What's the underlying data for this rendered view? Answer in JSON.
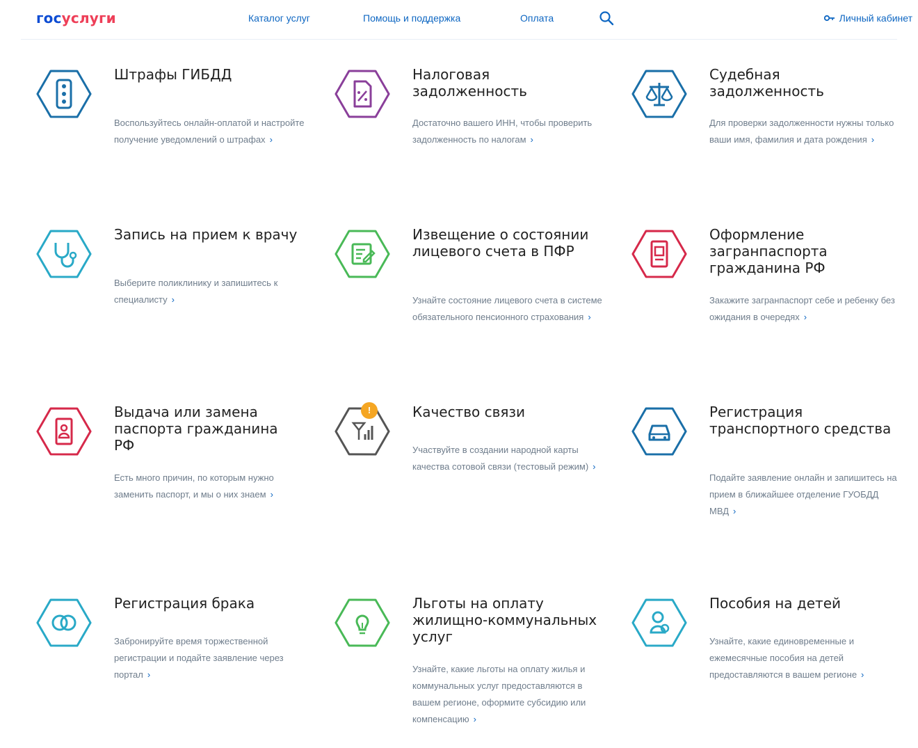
{
  "header": {
    "logo_part1": "гос",
    "logo_part2": "услуги",
    "nav": [
      "Каталог услуг",
      "Помощь и поддержка",
      "Оплата"
    ],
    "account_label": "Личный кабинет"
  },
  "colors": {
    "brand_blue": "#0d4cd3",
    "brand_red": "#ee3f58",
    "link": "#0d66c2"
  },
  "services": [
    {
      "title": "Штрафы ГИБДД",
      "description": "Воспользуйтесь онлайн-оплатой и настройте получение уведомлений о штрафах",
      "icon": "traffic-light-icon",
      "color": "#1a6fa8"
    },
    {
      "title": "Налоговая задолженность",
      "description": "Достаточно вашего ИНН, чтобы проверить задолженность по налогам",
      "icon": "tax-document-icon",
      "color": "#8a3f9a"
    },
    {
      "title": "Судебная задолженность",
      "description": "Для проверки задолженности нужны только ваши имя, фамилия и дата рождения",
      "icon": "scales-icon",
      "color": "#1a6fa8"
    },
    {
      "title": "Запись на прием к врачу",
      "description": "Выберите поликлинику и запишитесь к специалисту",
      "icon": "stethoscope-icon",
      "color": "#29a9c7"
    },
    {
      "title": "Извещение о состоянии лицевого счета в ПФР",
      "description": "Узнайте состояние лицевого счета в системе обязательного пенсионного страхования",
      "icon": "edit-document-icon",
      "color": "#49b957"
    },
    {
      "title": "Оформление загранпаспорта гражданина РФ",
      "description": "Закажите загранпаспорт себе и ребенку без ожидания в очередях",
      "icon": "passport-icon",
      "color": "#d6294a"
    },
    {
      "title": "Выдача или замена паспорта гражданина РФ",
      "description": "Есть много причин, по которым нужно заменить паспорт, и мы о них знаем",
      "icon": "id-passport-icon",
      "color": "#d6294a"
    },
    {
      "title": "Качество связи",
      "description": "Участвуйте в создании народной карты качества сотовой связи (тестовый режим)",
      "icon": "signal-icon",
      "color": "#555555",
      "badge": "!"
    },
    {
      "title": "Регистрация транспортного средства",
      "description": "Подайте заявление онлайн и запишитесь на прием в ближайшее отделение ГУОБДД МВД",
      "icon": "car-icon",
      "color": "#1a6fa8"
    },
    {
      "title": "Регистрация брака",
      "description": "Забронируйте время торжественной регистрации и подайте заявление через портал",
      "icon": "rings-icon",
      "color": "#29a9c7"
    },
    {
      "title": "Льготы на оплату жилищно-коммунальных услуг",
      "description": "Узнайте, какие льготы на оплату жилья и коммунальных услуг предоставляются в вашем регионе, оформите субсидию или компенсацию",
      "icon": "lightbulb-icon",
      "color": "#49b957"
    },
    {
      "title": "Пособия на детей",
      "description": "Узнайте, какие единовременные и ежемесячные пособия на детей предоставляются в вашем регионе",
      "icon": "child-icon",
      "color": "#29a9c7"
    }
  ]
}
